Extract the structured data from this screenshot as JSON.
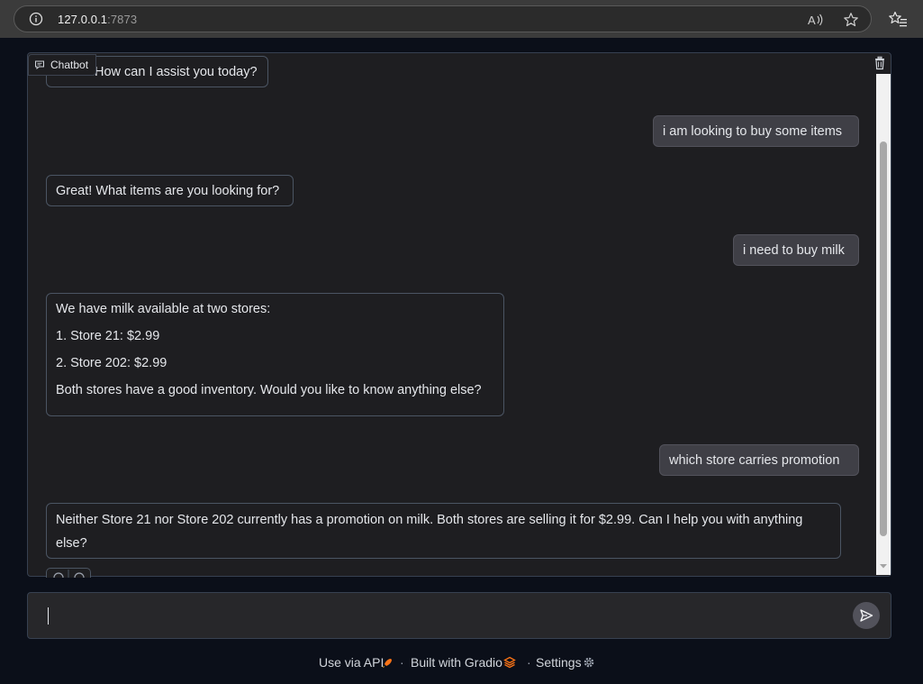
{
  "browser": {
    "url_host": "127.0.0.1",
    "url_port": ":7873"
  },
  "chatbot": {
    "label": "Chatbot",
    "messages": [
      {
        "role": "bot",
        "lines": [
          "How can I assist you today?"
        ]
      },
      {
        "role": "user",
        "lines": [
          "i am looking to buy some items"
        ]
      },
      {
        "role": "bot",
        "lines": [
          "Great! What items are you looking for?"
        ]
      },
      {
        "role": "user",
        "lines": [
          "i need to buy milk"
        ]
      },
      {
        "role": "bot",
        "lines": [
          "We have milk available at two stores:",
          "1. Store 21: $2.99",
          "2. Store 202: $2.99",
          "Both stores have a good inventory. Would you like to know anything else?"
        ]
      },
      {
        "role": "user",
        "lines": [
          "which store carries promotion"
        ]
      },
      {
        "role": "bot",
        "lines": [
          "Neither Store 21 nor Store 202 currently has a promotion on milk. Both stores are selling it for $2.99. Can I help you with anything else?"
        ]
      }
    ]
  },
  "input": {
    "value": ""
  },
  "footer": {
    "api": "Use via API",
    "sep": "·",
    "built": "Built with Gradio",
    "settings": "Settings"
  },
  "colors": {
    "background": "#0b0f19",
    "panel": "#1e1e21",
    "user_bubble": "#3f3f46",
    "gradio_orange": "#f97316"
  }
}
